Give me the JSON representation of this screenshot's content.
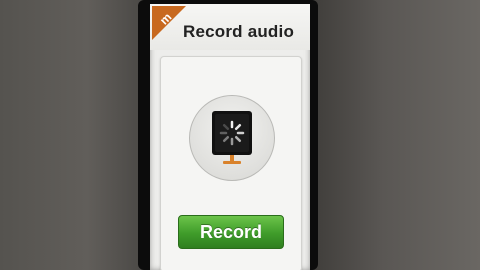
{
  "header": {
    "title": "Record audio",
    "badge_letter": "m",
    "badge_color": "#c8691f"
  },
  "main": {
    "status_icon": "microphone-loading-icon",
    "record_button_label": "Record",
    "record_button_color": "#4aa82f"
  }
}
